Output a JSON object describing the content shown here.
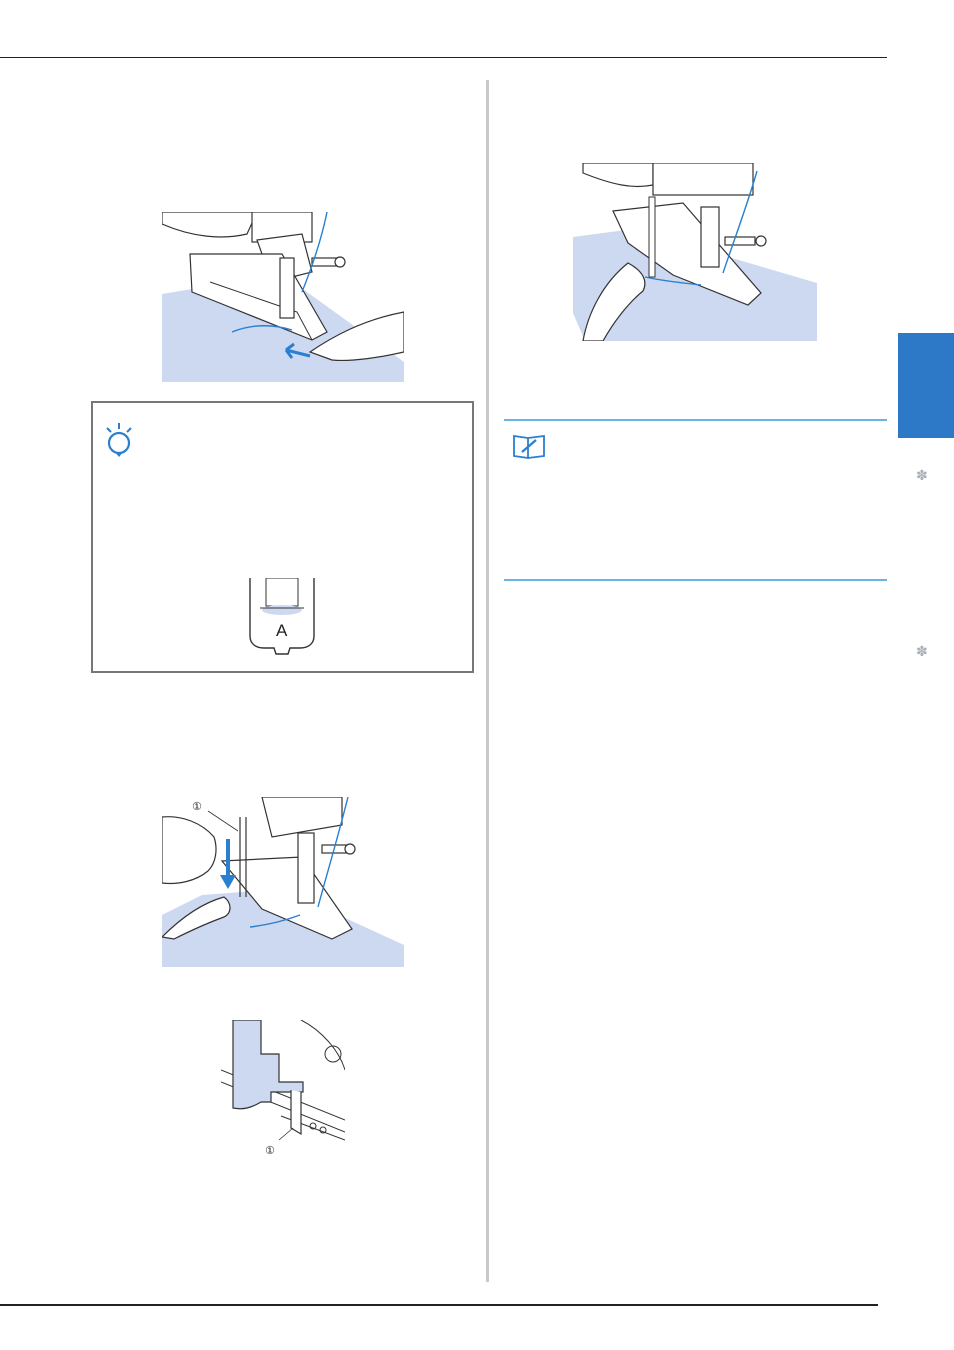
{
  "figures": {
    "fig_bottom_left_callout": "①",
    "fig_lever_callout": "①",
    "note_foot_letter": "A"
  },
  "icons": {
    "note_icon": "lightbulb-icon",
    "memo_icon": "memo-pencil-icon",
    "side_ornament": "fleuron-icon"
  },
  "colors": {
    "fabric": "#ccd9f1",
    "thread": "#2a7fd0",
    "chapter_tab": "#2e78c8",
    "memo_rule": "#6cb3e8"
  }
}
